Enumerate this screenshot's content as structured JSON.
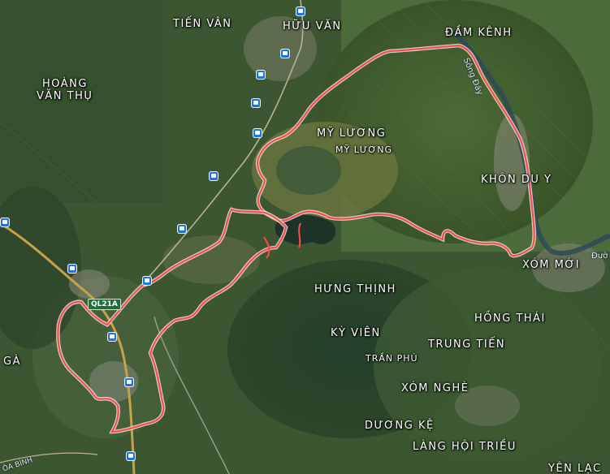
{
  "map": {
    "places": [
      {
        "id": "tien-van",
        "label": "TIẾN VÂN"
      },
      {
        "id": "huu-van",
        "label": "HỮU VĂN"
      },
      {
        "id": "dam-kenh",
        "label": "ĐẦM KÊNH"
      },
      {
        "id": "hoang-van-thu-1",
        "label": "HOÀNG"
      },
      {
        "id": "hoang-van-thu-2",
        "label": "VĂN THỤ"
      },
      {
        "id": "my-luong-1",
        "label": "MỸ LƯƠNG"
      },
      {
        "id": "my-luong-2",
        "label": "MỸ LƯƠNG"
      },
      {
        "id": "khon-du-y",
        "label": "KHÔN DU Y"
      },
      {
        "id": "xom-moi",
        "label": "XÓM MỚI"
      },
      {
        "id": "hung-thinh",
        "label": "HƯNG THỊNH"
      },
      {
        "id": "hong-thai",
        "label": "HỒNG THÁI"
      },
      {
        "id": "ky-vien",
        "label": "KỲ VIÊN"
      },
      {
        "id": "trung-tien",
        "label": "TRUNG TIẾN"
      },
      {
        "id": "tran-phu",
        "label": "TRẦN PHÚ"
      },
      {
        "id": "xom-nghe",
        "label": "XÓM NGHÈ"
      },
      {
        "id": "duong-ke",
        "label": "DƯƠNG KỆ"
      },
      {
        "id": "lang-hoi-trieu",
        "label": "LÀNG HỘI TRIỀU"
      },
      {
        "id": "yen-lac",
        "label": "YÊN LẠC"
      },
      {
        "id": "ga",
        "label": "GÀ"
      }
    ],
    "road_shield": "QL21A",
    "river_label": "Sông Đáy",
    "road_label": "Đườ",
    "edge_label": "ÒA BÌNH",
    "boundary_color": "#ff4a4a",
    "bus_stop_icon": "bus-stop-icon"
  }
}
